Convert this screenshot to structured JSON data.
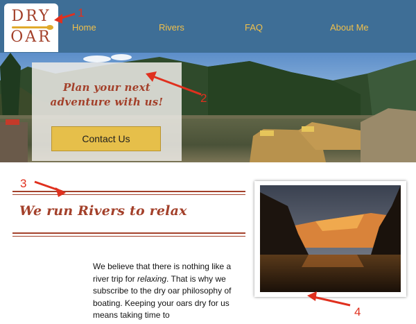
{
  "logo": {
    "line1": "DRY",
    "line2": "OAR"
  },
  "nav": {
    "items": [
      "Home",
      "Rivers",
      "FAQ",
      "About Me"
    ]
  },
  "hero": {
    "title": "Plan your next adventure with us!",
    "button_label": "Contact Us"
  },
  "section": {
    "title": "We run Rivers to relax",
    "body_before": "We believe that there is nothing like a river trip for ",
    "body_em": "relaxing",
    "body_after": ". That is why we subscribe to the dry oar philosophy of boating. Keeping your oars dry for us means taking time to"
  },
  "annotations": [
    "1",
    "2",
    "3",
    "4"
  ],
  "colors": {
    "header": "#3e6e96",
    "nav_text": "#f1c04b",
    "brand": "#a3402a",
    "button": "#e6bf4a",
    "annotation": "#e0301e"
  }
}
